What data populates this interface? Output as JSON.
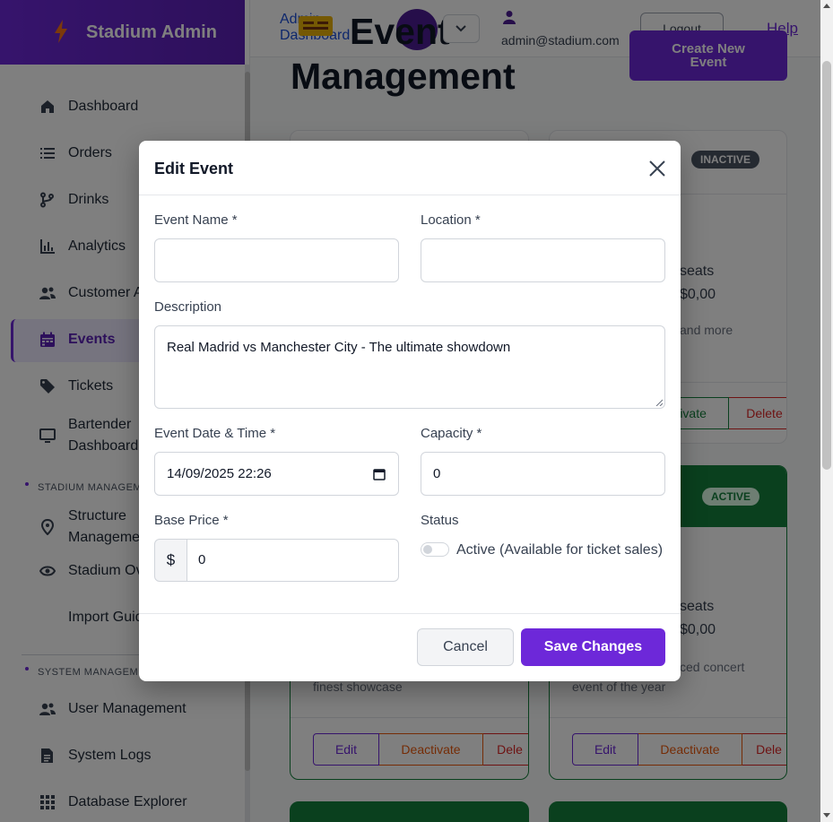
{
  "app": {
    "name": "Stadium Admin"
  },
  "sidebar": {
    "items": [
      {
        "label": "Dashboard",
        "icon": "home-icon"
      },
      {
        "label": "Orders",
        "icon": "list-icon"
      },
      {
        "label": "Drinks",
        "icon": "branch-icon"
      },
      {
        "label": "Analytics",
        "icon": "bar-chart-icon"
      },
      {
        "label": "Customer A",
        "icon": "users-icon"
      },
      {
        "label": "Events",
        "icon": "calendar-icon"
      },
      {
        "label": "Tickets",
        "icon": "tag-icon"
      },
      {
        "label": "Bartender",
        "label2": "Dashboard",
        "icon": "monitor-icon"
      },
      {
        "label": "Structure",
        "label2": "Manageme",
        "icon": "location-icon"
      },
      {
        "label": "Stadium Ov",
        "icon": "eye-icon"
      },
      {
        "label": "Import Guid",
        "icon": ""
      },
      {
        "label": "User Management",
        "icon": "users-icon"
      },
      {
        "label": "System Logs",
        "icon": "logs-icon"
      },
      {
        "label": "Database Explorer",
        "icon": "grid-icon"
      }
    ],
    "sections": {
      "stadium": "STADIUM MANAGEM",
      "system": "SYSTEM MANAGEM"
    }
  },
  "header": {
    "breadcrumb_l1": "Admin",
    "breadcrumb_l2": "Dashboard",
    "title_l1": "Event",
    "title_l2": "Management",
    "user_email": "admin@stadium.com",
    "logout": "Logout",
    "help": "Help",
    "create_l1": "Create New",
    "create_l2": "Event"
  },
  "cards": {
    "c1": {
      "badge": "INACTIVE",
      "seats": "seats",
      "price": "$0,00",
      "desc": "and more",
      "activate": "Activate",
      "delete": "Delete"
    },
    "c2": {
      "badge": "ACTIVE",
      "seats": "seats",
      "price": "$0,00",
      "desc_l1": "ced concert",
      "desc_l2": "event of the year",
      "edit": "Edit",
      "deactivate": "Deactivate",
      "delete": "Dele"
    },
    "c3": {
      "desc": "finest showcase",
      "edit": "Edit",
      "deactivate": "Deactivate",
      "delete": "Dele"
    }
  },
  "modal": {
    "title": "Edit Event",
    "event_name_label": "Event Name *",
    "event_name_value": "",
    "location_label": "Location *",
    "location_value": "",
    "description_label": "Description",
    "description_value": "Real Madrid vs Manchester City - The ultimate showdown",
    "date_label": "Event Date & Time *",
    "date_value": "14/09/2025 22:26",
    "capacity_label": "Capacity *",
    "capacity_value": "0",
    "price_label": "Base Price *",
    "currency": "$",
    "price_value": "0",
    "status_label": "Status",
    "status_text": "Active (Available for ticket sales)",
    "status_active": false,
    "cancel": "Cancel",
    "save": "Save Changes"
  },
  "colors": {
    "primary": "#6d28d9",
    "active_green": "#15803d",
    "inactive_gray": "#4b5563"
  }
}
